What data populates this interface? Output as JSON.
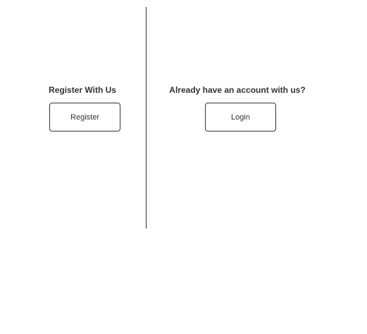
{
  "register_panel": {
    "heading": "Register With Us",
    "button_label": "Register"
  },
  "login_panel": {
    "heading": "Already have an account with us?",
    "button_label": "Login"
  },
  "colors": {
    "text": "#333333",
    "border": "#333333",
    "background": "#ffffff"
  }
}
